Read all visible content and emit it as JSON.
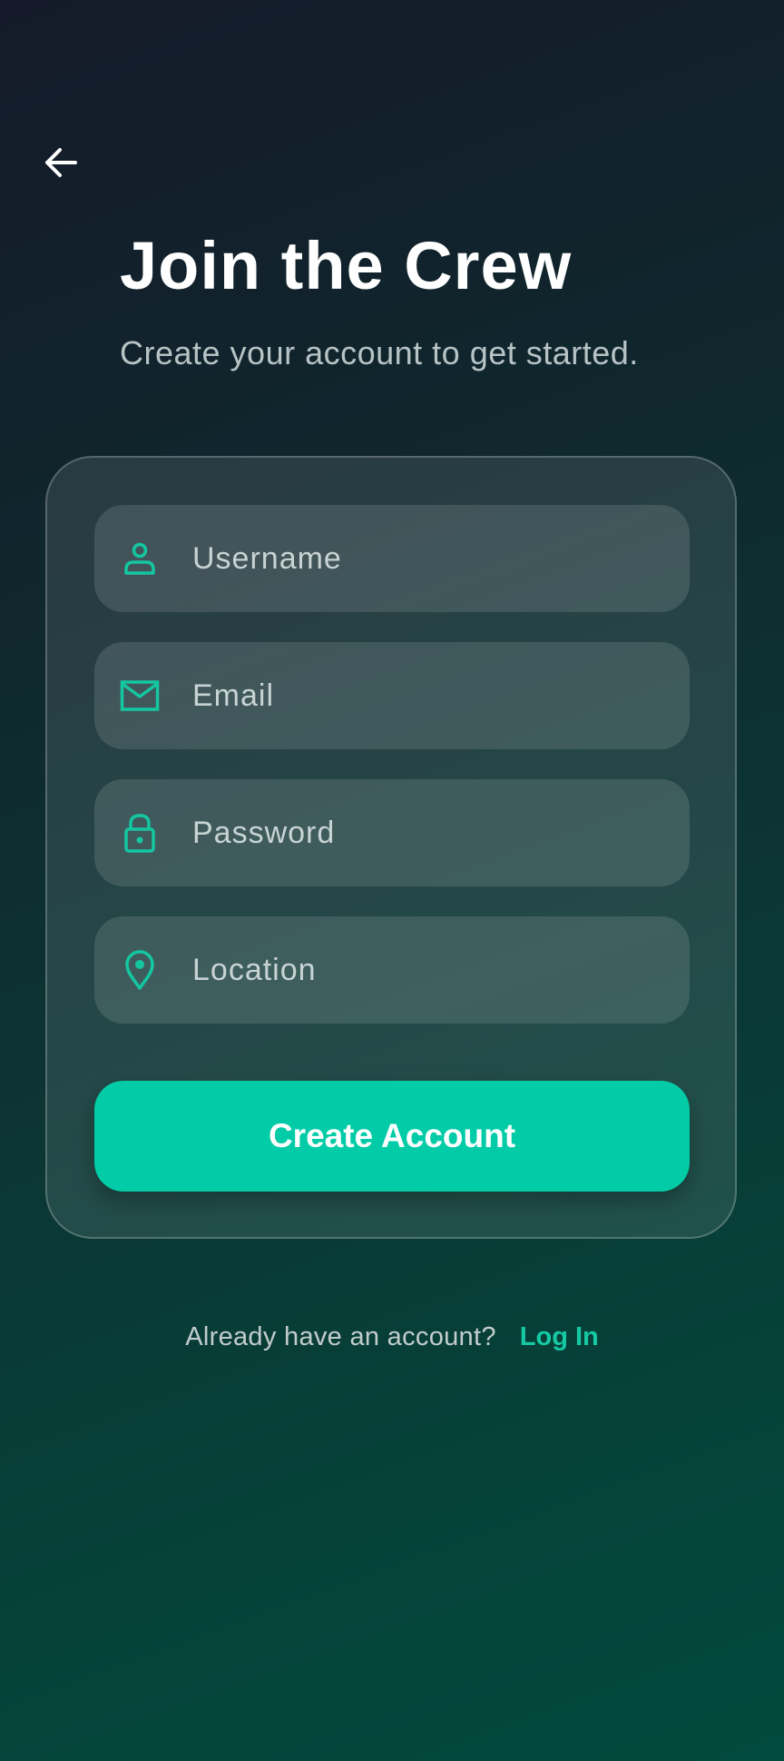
{
  "header": {
    "back_icon": "arrow-left-icon",
    "title": "Join the Crew",
    "subtitle": "Create your account to get started."
  },
  "form": {
    "fields": [
      {
        "icon": "user-icon",
        "placeholder": "Username"
      },
      {
        "icon": "mail-icon",
        "placeholder": "Email"
      },
      {
        "icon": "lock-icon",
        "placeholder": "Password"
      },
      {
        "icon": "map-pin-icon",
        "placeholder": "Location"
      }
    ],
    "submit_label": "Create Account"
  },
  "footer": {
    "prompt": "Already have an account?",
    "login_label": "Log In"
  },
  "colors": {
    "accent": "#02cba7",
    "link": "#16c9a4",
    "icon": "#14c7a1",
    "background_top": "#141a29",
    "background_bottom": "#024a3d"
  }
}
